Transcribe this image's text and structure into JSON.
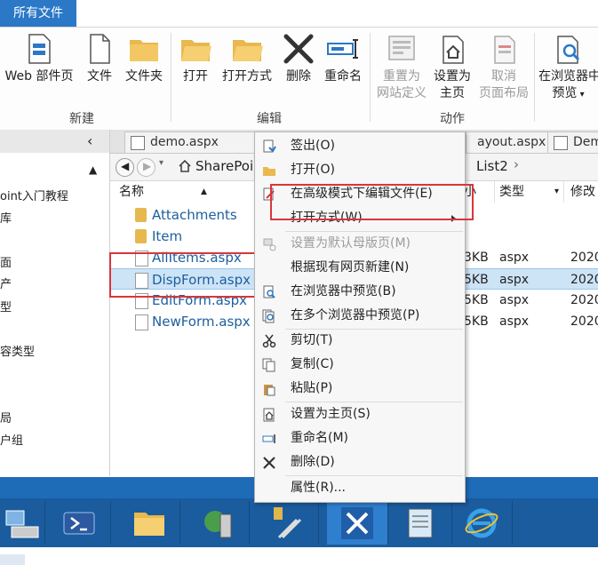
{
  "ribbon": {
    "tab_label": "所有文件",
    "buttons": {
      "web_part_page": "Web 部件页",
      "file": "文件",
      "folder": "文件夹",
      "open": "打开",
      "open_with": "打开方式",
      "delete": "删除",
      "rename": "重命名",
      "reset_def_1": "重置为",
      "reset_def_2": "网站定义",
      "set_home_1": "设置为",
      "set_home_2": "主页",
      "cancel_layout_1": "取消",
      "cancel_layout_2": "页面布局",
      "preview_1": "在浏览器中",
      "preview_2": "预览"
    },
    "groups": {
      "new": "新建",
      "edit": "编辑",
      "actions": "动作"
    }
  },
  "leftnav": {
    "items": [
      "oint入门教程",
      "库",
      "面",
      "产",
      "型",
      "容类型",
      "局",
      "户组"
    ]
  },
  "doctabs": [
    "demo.aspx",
    "ayout.aspx",
    "Dem"
  ],
  "address": {
    "path": "SharePoi",
    "tail": "List2"
  },
  "filelist": {
    "headers": {
      "name": "名称",
      "size": "小",
      "type": "类型",
      "modified": "修改"
    },
    "rows": [
      {
        "name": "Attachments",
        "size": "",
        "type": "",
        "date": ""
      },
      {
        "name": "Item",
        "size": "",
        "type": "",
        "date": ""
      },
      {
        "name": "AllItems.aspx",
        "size": "3KB",
        "type": "aspx",
        "date": "2020"
      },
      {
        "name": "DispForm.aspx",
        "size": "5KB",
        "type": "aspx",
        "date": "2020"
      },
      {
        "name": "EditForm.aspx",
        "size": "5KB",
        "type": "aspx",
        "date": "2020"
      },
      {
        "name": "NewForm.aspx",
        "size": "5KB",
        "type": "aspx",
        "date": "2020"
      }
    ]
  },
  "context_menu": {
    "items": [
      {
        "label": "签出(O)",
        "icon": "checkout-icon"
      },
      {
        "label": "打开(O)",
        "icon": "open-folder-icon"
      },
      {
        "label": "在高级模式下编辑文件(E)",
        "icon": "edit-advanced-icon"
      },
      {
        "label": "打开方式(W)",
        "icon": ""
      },
      {
        "label": "设置为默认母版页(M)",
        "icon": "master-page-icon"
      },
      {
        "label": "根据现有网页新建(N)",
        "icon": ""
      },
      {
        "label": "在浏览器中预览(B)",
        "icon": "preview-icon"
      },
      {
        "label": "在多个浏览器中预览(P)",
        "icon": "multi-preview-icon"
      },
      {
        "label": "剪切(T)",
        "icon": "scissors-icon"
      },
      {
        "label": "复制(C)",
        "icon": "copy-icon"
      },
      {
        "label": "粘贴(P)",
        "icon": "paste-icon"
      },
      {
        "label": "设置为主页(S)",
        "icon": "home-icon"
      },
      {
        "label": "重命名(M)",
        "icon": "rename-icon"
      },
      {
        "label": "删除(D)",
        "icon": "delete-x-icon"
      },
      {
        "label": "属性(R)...",
        "icon": ""
      }
    ]
  },
  "colors": {
    "accent": "#2b78c6",
    "highlight_box": "#d9363b",
    "taskbar": "#1a5c9e"
  }
}
